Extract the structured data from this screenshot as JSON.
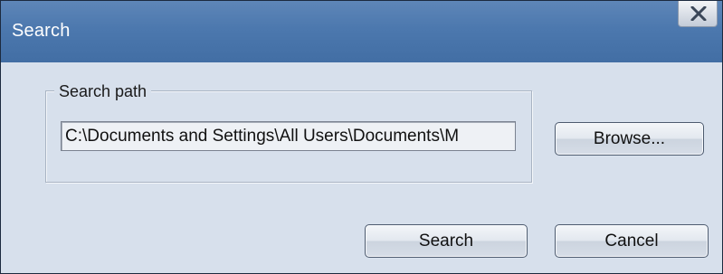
{
  "window": {
    "title": "Search",
    "close_icon": "close-x-icon"
  },
  "group": {
    "legend": "Search path"
  },
  "path_field": {
    "value": "C:\\Documents and Settings\\All Users\\Documents\\M"
  },
  "buttons": {
    "browse_label": "Browse...",
    "search_label": "Search",
    "cancel_label": "Cancel"
  }
}
